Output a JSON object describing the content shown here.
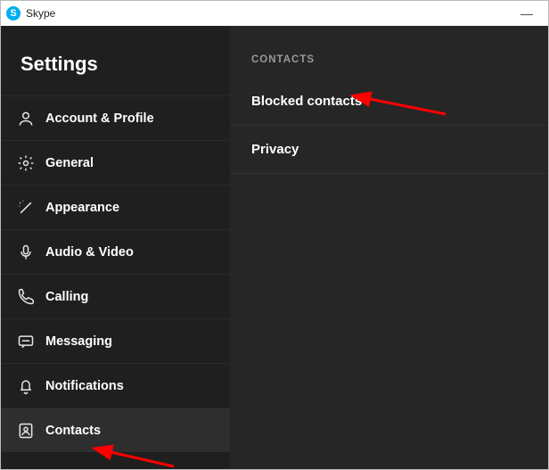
{
  "titlebar": {
    "app_name": "Skype"
  },
  "sidebar": {
    "title": "Settings",
    "items": [
      {
        "icon": "user-icon",
        "label": "Account & Profile"
      },
      {
        "icon": "gear-icon",
        "label": "General"
      },
      {
        "icon": "wand-icon",
        "label": "Appearance"
      },
      {
        "icon": "mic-icon",
        "label": "Audio & Video"
      },
      {
        "icon": "phone-icon",
        "label": "Calling"
      },
      {
        "icon": "message-icon",
        "label": "Messaging"
      },
      {
        "icon": "bell-icon",
        "label": "Notifications"
      },
      {
        "icon": "contacts-icon",
        "label": "Contacts"
      }
    ]
  },
  "content": {
    "section_title": "CONTACTS",
    "rows": [
      {
        "label": "Blocked contacts"
      },
      {
        "label": "Privacy"
      }
    ]
  },
  "annotations": {
    "arrow_color": "#ff0000"
  }
}
